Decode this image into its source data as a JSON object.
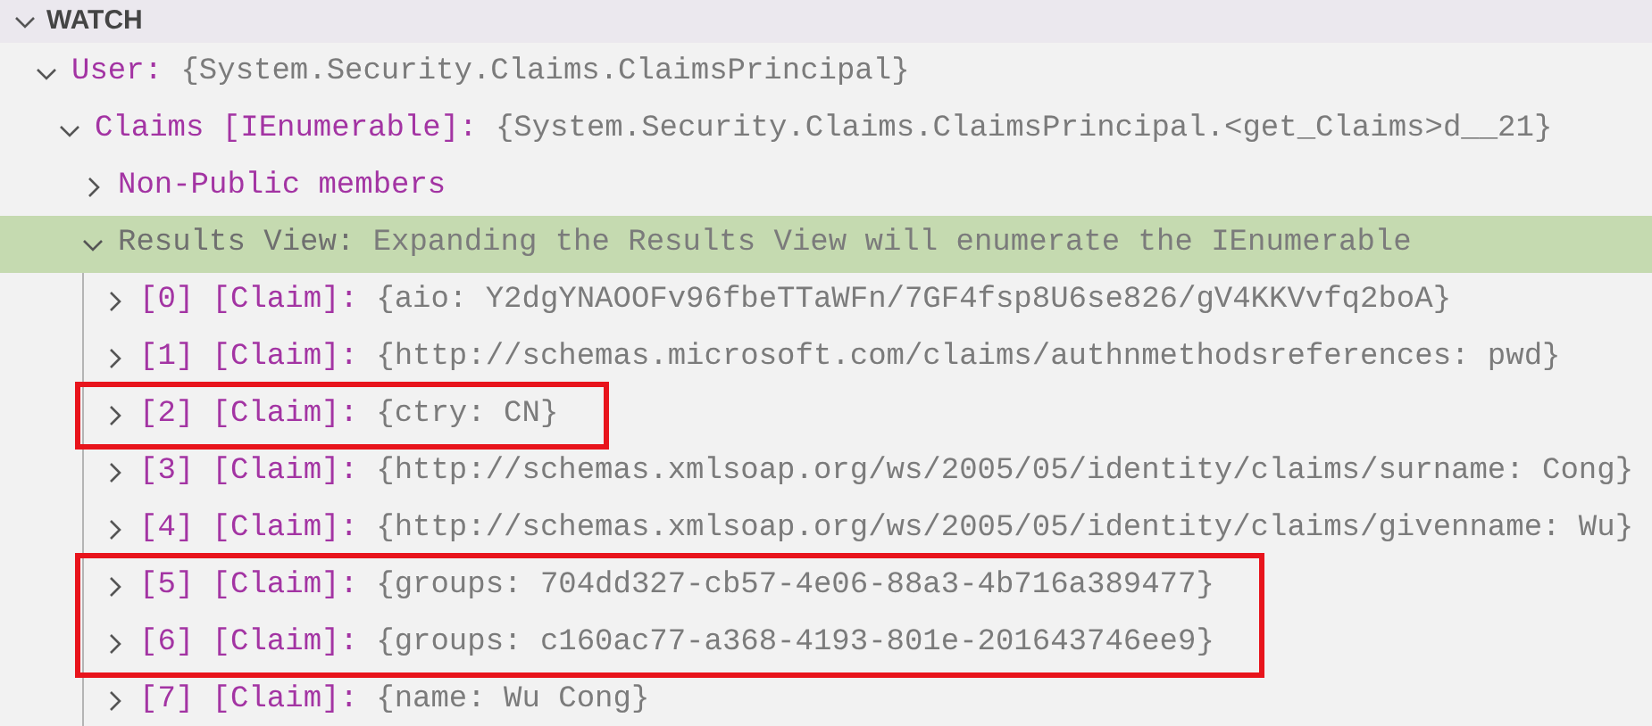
{
  "panel": {
    "title": "WATCH",
    "expanded": true
  },
  "tree": [
    {
      "kind": "member",
      "name": "User:",
      "value": "{System.Security.Claims.ClaimsPrincipal}",
      "expanded": true,
      "selected": false,
      "children": [
        {
          "kind": "member",
          "name": "Claims [IEnumerable]:",
          "value": "{System.Security.Claims.ClaimsPrincipal.<get_Claims>d__21}",
          "expanded": true,
          "selected": false,
          "children": [
            {
              "kind": "member",
              "name": "Non-Public members",
              "expanded": false,
              "selected": false
            },
            {
              "kind": "info",
              "name": "Results View:",
              "value": "Expanding the Results View will enumerate the IEnumerable",
              "expanded": true,
              "selected": true,
              "children": [
                {
                  "kind": "member",
                  "name": "[0] [Claim]:",
                  "value": "{aio: Y2dgYNAOOFv96fbeTTaWFn/7GF4fsp8U6se826/gV4KKVvfq2boA}",
                  "expanded": false,
                  "selected": false,
                  "outlined": false
                },
                {
                  "kind": "member",
                  "name": "[1] [Claim]:",
                  "value": "{http://schemas.microsoft.com/claims/authnmethodsreferences: pwd}",
                  "expanded": false,
                  "selected": false,
                  "outlined": false
                },
                {
                  "kind": "member",
                  "name": "[2] [Claim]:",
                  "value": "{ctry: CN}",
                  "expanded": false,
                  "selected": false,
                  "outlined": true
                },
                {
                  "kind": "member",
                  "name": "[3] [Claim]:",
                  "value": "{http://schemas.xmlsoap.org/ws/2005/05/identity/claims/surname: Cong}",
                  "expanded": false,
                  "selected": false,
                  "outlined": false
                },
                {
                  "kind": "member",
                  "name": "[4] [Claim]:",
                  "value": "{http://schemas.xmlsoap.org/ws/2005/05/identity/claims/givenname: Wu}",
                  "expanded": false,
                  "selected": false,
                  "outlined": false
                },
                {
                  "kind": "member",
                  "name": "[5] [Claim]:",
                  "value": "{groups: 704dd327-cb57-4e06-88a3-4b716a389477}",
                  "expanded": false,
                  "selected": false,
                  "outlined": true
                },
                {
                  "kind": "member",
                  "name": "[6] [Claim]:",
                  "value": "{groups: c160ac77-a368-4193-801e-201643746ee9}",
                  "expanded": false,
                  "selected": false,
                  "outlined": true
                },
                {
                  "kind": "member",
                  "name": "[7] [Claim]:",
                  "value": "{name: Wu Cong}",
                  "expanded": false,
                  "selected": false,
                  "outlined": false
                }
              ]
            }
          ]
        }
      ]
    }
  ]
}
